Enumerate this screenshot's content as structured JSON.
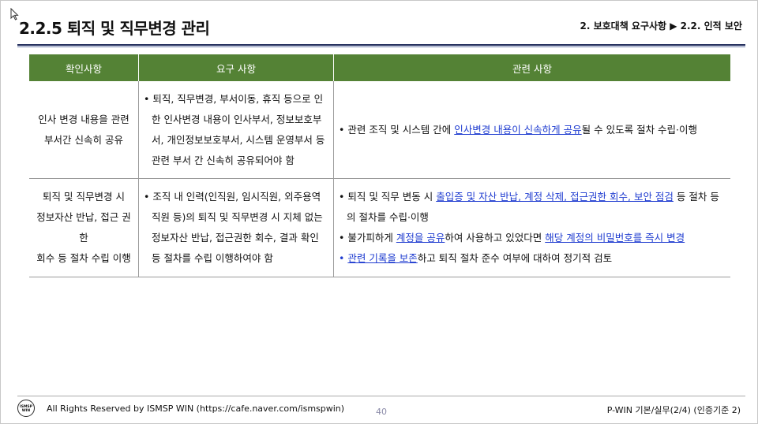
{
  "header": {
    "title": "2.2.5 퇴직 및 직무변경 관리",
    "breadcrumb": "2. 보호대책 요구사항 ▶ 2.2. 인적 보안"
  },
  "table": {
    "headers": [
      "확인사항",
      "요구 사항",
      "관련 사항"
    ],
    "rows": [
      {
        "check_lines": [
          "인사 변경 내용을 관련",
          "부서간 신속히 공유"
        ],
        "requirement": "퇴직, 직무변경, 부서이동, 휴직 등으로 인한 인사변경 내용이 인사부서, 정보보호부서, 개인정보보호부서, 시스템 운영부서 등 관련 부서 간 신속히 공유되어야 함",
        "related": [
          {
            "pre": "관련 조직 및 시스템 간에 ",
            "link": "인사변경 내용이 신속하게 공유",
            "post": "될 수 있도록 절차 수립·이행"
          }
        ]
      },
      {
        "check_lines": [
          "퇴직 및 직무변경 시",
          "정보자산 반납, 접근 권한",
          "회수 등 절차 수립 이행"
        ],
        "requirement": "조직 내 인력(인직원, 임시직원, 외주용역직원 등)의 퇴직 및 직무변경 시 지체 없는 정보자산 반납, 접근권한 회수, 결과 확인 등 절차를 수립 이행하여야 함",
        "related": [
          {
            "pre": "퇴직 및 직무 변동 시 ",
            "link": "출입증 및 자산 반납, 계정 삭제, 접근권한 회수, 보안 점검",
            "post": " 등 절차 등의 절차를 수립·이행"
          },
          {
            "pre": "불가피하게 ",
            "link": "계정을 공유",
            "mid": "하여 사용하고 있었다면 ",
            "link2": "해당 계정의 비밀번호를 즉시 변경",
            "post": ""
          },
          {
            "pre": "",
            "link": "관련 기록을 보존",
            "post": "하고 퇴직 절차 준수 여부에 대하여 정기적 검토"
          }
        ]
      }
    ]
  },
  "footer": {
    "logo_text": "ISMSP WIN",
    "rights": "All Rights Reserved by ISMSP WIN (https://cafe.naver.com/ismspwin)",
    "page_number": "40",
    "right_text": "P-WIN 기본/실무(2/4) (인증기준 2)"
  }
}
